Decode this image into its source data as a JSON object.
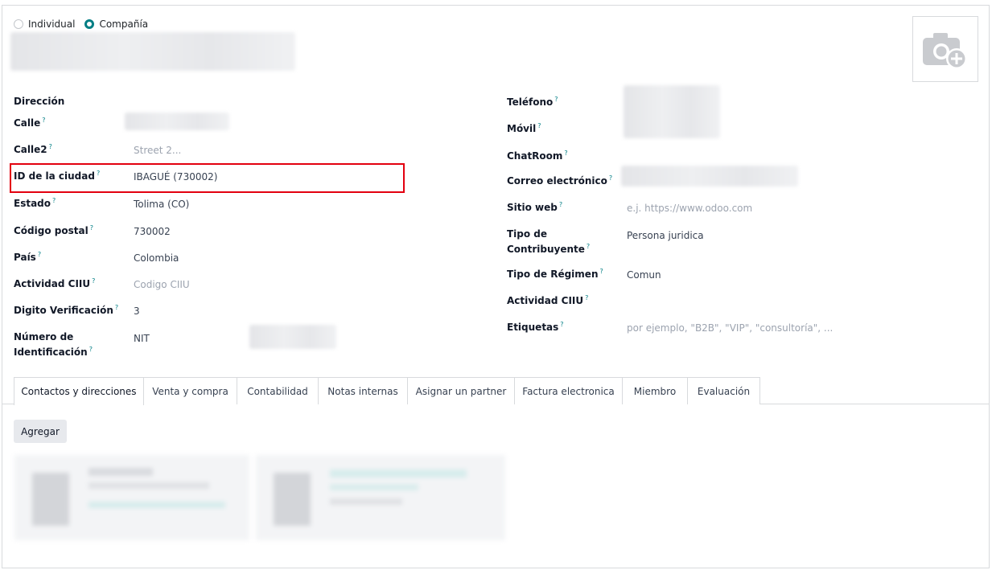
{
  "type_selector": {
    "individual_label": "Individual",
    "company_label": "Compañía",
    "selected": "Compañía"
  },
  "left_fields": {
    "address_header": "Dirección",
    "street_label": "Calle",
    "street2_label": "Calle2",
    "street2_placeholder": "Street 2...",
    "city_id_label": "ID de la ciudad",
    "city_id_value": "IBAGUÉ (730002)",
    "state_label": "Estado",
    "state_value": "Tolima (CO)",
    "zip_label": "Código postal",
    "zip_value": "730002",
    "country_label": "País",
    "country_value": "Colombia",
    "ciiu_label": "Actividad CIIU",
    "ciiu_placeholder": "Codigo CIIU",
    "dv_label": "Digito Verificación",
    "dv_value": "3",
    "id_number_label_1": "Número de",
    "id_number_label_2": "Identificación",
    "id_type_value": "NIT"
  },
  "right_fields": {
    "phone_label": "Teléfono",
    "mobile_label": "Móvil",
    "chatroom_label": "ChatRoom",
    "email_label": "Correo electrónico",
    "website_label": "Sitio web",
    "website_placeholder": "e.j. https://www.odoo.com",
    "taxpayer_label_1": "Tipo de",
    "taxpayer_label_2": "Contribuyente",
    "taxpayer_value": "Persona juridica",
    "regime_label": "Tipo de Régimen",
    "regime_value": "Comun",
    "ciiu_label": "Actividad CIIU",
    "tags_label": "Etiquetas",
    "tags_placeholder": "por ejemplo, \"B2B\", \"VIP\", \"consultoría\", ..."
  },
  "help_mark": "?",
  "tabs": [
    {
      "label": "Contactos y direcciones"
    },
    {
      "label": "Venta y compra"
    },
    {
      "label": "Contabilidad"
    },
    {
      "label": "Notas internas"
    },
    {
      "label": "Asignar un partner"
    },
    {
      "label": "Factura electronica"
    },
    {
      "label": "Miembro"
    },
    {
      "label": "Evaluación"
    }
  ],
  "contacts": {
    "add_button": "Agregar"
  },
  "colors": {
    "accent": "#017e84",
    "highlight": "#e3000f"
  },
  "icons": {
    "photo": "camera-plus-icon"
  }
}
